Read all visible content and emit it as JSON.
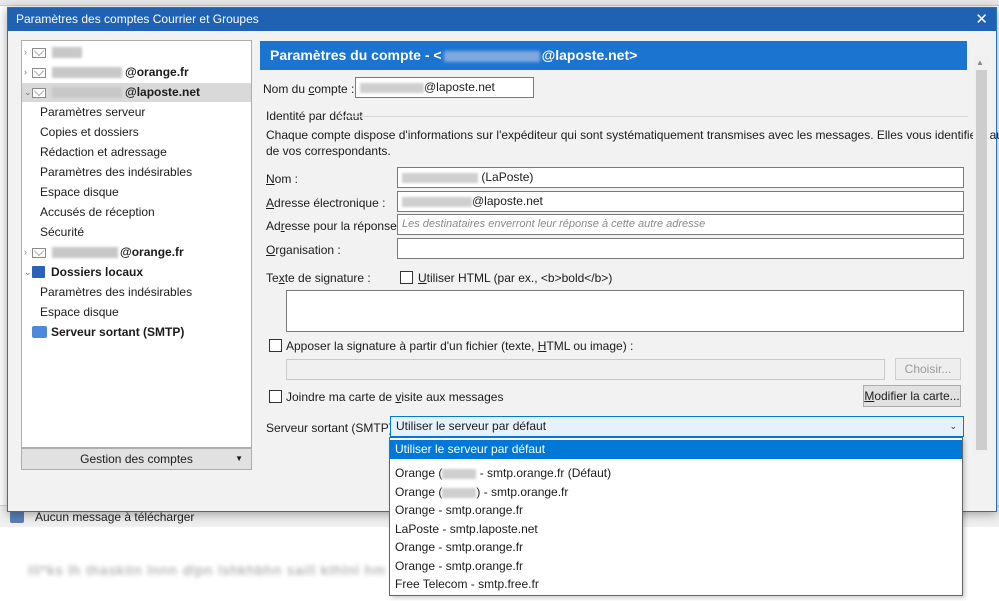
{
  "background": {
    "status_text": "Aucun message à télécharger",
    "blurred_text": "Ill*ks lh thaskitn lnnn dlpn lshkhbhn saill kthlnl hm"
  },
  "dialog": {
    "title": "Paramètres des comptes Courrier et Groupes",
    "close_label": "✕"
  },
  "tree": {
    "account1_label": "",
    "account2_label": "@orange.fr",
    "account3_label": "@laposte.net",
    "account3_children": [
      "Paramètres serveur",
      "Copies et dossiers",
      "Rédaction et adressage",
      "Paramètres des indésirables",
      "Espace disque",
      "Accusés de réception",
      "Sécurité"
    ],
    "account4_label": "@orange.fr",
    "local_folders_label": "Dossiers locaux",
    "local_children": [
      "Paramètres des indésirables",
      "Espace disque"
    ],
    "smtp_label": "Serveur sortant (SMTP)",
    "manage_button": "Gestion des comptes"
  },
  "panel": {
    "header_prefix": "Paramètres du compte - <",
    "header_suffix": "@laposte.net>",
    "account_name_label_1": "Nom du ",
    "account_name_label_u": "c",
    "account_name_label_2": "ompte :",
    "account_name_value": "@laposte.net",
    "identity_title": "Identité par défaut",
    "identity_desc_1": "Chaque compte dispose d'informations sur l'expéditeur qui sont systématiquement transmises avec les messages. Elles vous identifient auprès",
    "identity_desc_2": "de vos correspondants.",
    "name_label_u": "N",
    "name_label": "om :",
    "name_value": "(LaPoste)",
    "email_label_u": "A",
    "email_label": "dresse électronique :",
    "email_value": "@laposte.net",
    "reply_label_1": "Ad",
    "reply_label_u": "r",
    "reply_label_2": "esse pour la réponse :",
    "reply_placeholder": "Les destinataires enverront leur réponse à cette autre adresse",
    "org_label_u": "O",
    "org_label": "rganisation :",
    "org_value": "",
    "sig_label_1": "Te",
    "sig_label_u": "x",
    "sig_label_2": "te de signature :",
    "html_check_u": "U",
    "html_check_label": "tiliser HTML (par ex., <b>bold</b>)",
    "file_sig_label_1": "Apposer la signature à partir d'un fichier (texte, ",
    "file_sig_label_u": "H",
    "file_sig_label_2": "TML ou image) :",
    "choose_button": "Choisir...",
    "vcard_label_1": "Joindre ma carte de ",
    "vcard_label_u": "v",
    "vcard_label_2": "isite aux messages",
    "edit_card_button_u": "M",
    "edit_card_button": "odifier la carte...",
    "smtp_label": "Serveur sortant (SMTP) :",
    "smtp_selected": "Utiliser le serveur par défaut"
  },
  "dropdown": {
    "options": [
      "Utiliser le serveur par défaut",
      "Orange (",
      "Orange (",
      "Orange - smtp.orange.fr",
      "LaPoste - smtp.laposte.net",
      "Orange - smtp.orange.fr",
      "Orange - smtp.orange.fr",
      "Free Telecom - smtp.free.fr"
    ],
    "opt1_suffix": " - smtp.orange.fr (Défaut)",
    "opt2_suffix": ") - smtp.orange.fr"
  }
}
